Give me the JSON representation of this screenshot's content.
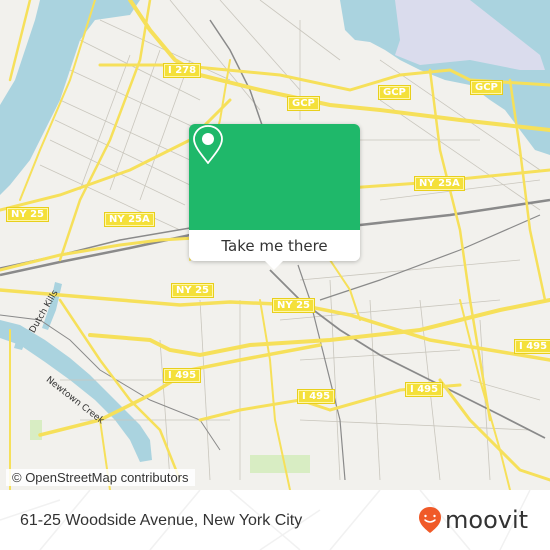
{
  "map": {
    "colors": {
      "land": "#f2f1ed",
      "water": "#aad3df",
      "major_road": "#f6e05a",
      "minor_road": "#c9c6bd",
      "rail": "#8a8a8a",
      "park": "#cdebb0",
      "airport": "#e6dff0"
    },
    "shields": [
      {
        "label": "I 278"
      },
      {
        "label": "GCP"
      },
      {
        "label": "GCP"
      },
      {
        "label": "GCP"
      },
      {
        "label": "NY 25A"
      },
      {
        "label": "NY 25A"
      },
      {
        "label": "NY 25"
      },
      {
        "label": "NY 25"
      },
      {
        "label": "NY 25"
      },
      {
        "label": "I 495"
      },
      {
        "label": "I 495"
      },
      {
        "label": "I 495"
      },
      {
        "label": "I 495"
      }
    ],
    "water_labels": [
      {
        "label": "Newtown Creek"
      },
      {
        "label": "Dutch Kills"
      }
    ],
    "attribution": "© OpenStreetMap contributors"
  },
  "popup": {
    "icon": "map-pin-icon",
    "button_label": "Take me there",
    "color": "#1fb86a"
  },
  "footer": {
    "address": "61-25 Woodside Avenue, New York City",
    "brand": "moovit",
    "brand_icon": "moovit-pin-icon",
    "brand_color": "#f05a28"
  }
}
